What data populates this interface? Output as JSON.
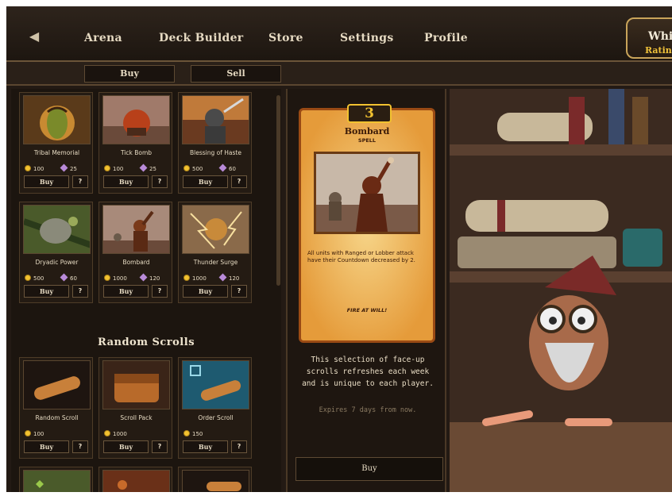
{
  "nav": {
    "items": [
      "Arena",
      "Deck Builder",
      "Store",
      "Settings",
      "Profile"
    ],
    "player_name": "White",
    "rating_label": "Rating"
  },
  "tabs": {
    "buy": "Buy",
    "sell": "Sell"
  },
  "scrolls": [
    {
      "name": "Tribal Memorial",
      "gold": "100",
      "shards": "25",
      "buy": "Buy",
      "info": "?"
    },
    {
      "name": "Tick Bomb",
      "gold": "100",
      "shards": "25",
      "buy": "Buy",
      "info": "?"
    },
    {
      "name": "Blessing of Haste",
      "gold": "500",
      "shards": "60",
      "buy": "Buy",
      "info": "?"
    },
    {
      "name": "Dryadic Power",
      "gold": "500",
      "shards": "60",
      "buy": "Buy",
      "info": "?"
    },
    {
      "name": "Bombard",
      "gold": "1000",
      "shards": "120",
      "buy": "Buy",
      "info": "?"
    },
    {
      "name": "Thunder Surge",
      "gold": "1000",
      "shards": "120",
      "buy": "Buy",
      "info": "?"
    }
  ],
  "random_section_title": "Random Scrolls",
  "random_scrolls": [
    {
      "name": "Random Scroll",
      "gold": "100",
      "buy": "Buy",
      "info": "?"
    },
    {
      "name": "Scroll Pack",
      "gold": "1000",
      "buy": "Buy",
      "info": "?"
    },
    {
      "name": "Order Scroll",
      "gold": "150",
      "buy": "Buy",
      "info": "?"
    }
  ],
  "detail": {
    "cost": "3",
    "name": "Bombard",
    "type": "SPELL",
    "rules": "All units with Ranged or Lobber attack have their Countdown decreased by 2.",
    "flavor": "FIRE AT WILL!",
    "description": "This selection of face-up scrolls refreshes each week and is unique to each player.",
    "expires": "Expires 7 days from now.",
    "buy": "Buy"
  },
  "colors": {
    "gold": "#f2c230",
    "shard": "#b88ad8",
    "panel": "#1c150f",
    "accent": "#c9a45a"
  }
}
